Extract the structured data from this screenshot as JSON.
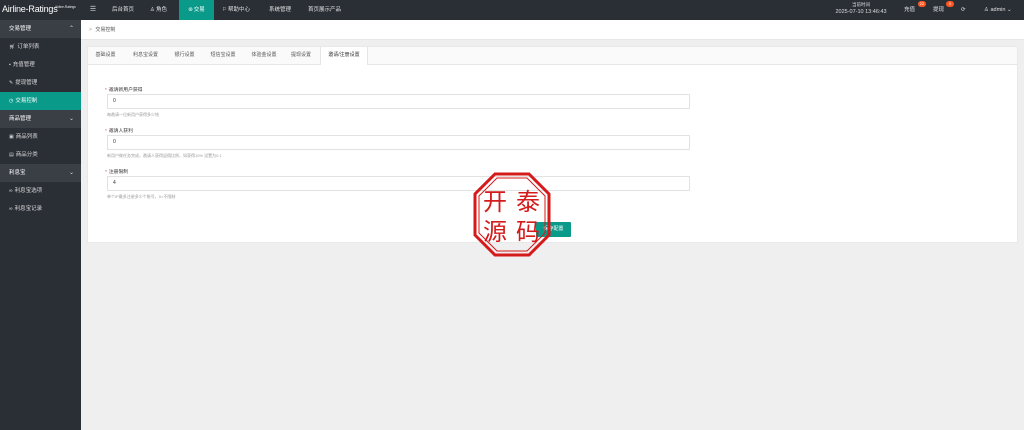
{
  "app": {
    "logo_text": "Airline-Ratings",
    "logo_subtext": "Airline-Ratings"
  },
  "topnav": {
    "items": [
      {
        "label": "后台首页",
        "icon": ""
      },
      {
        "label": "角色",
        "icon": "user-icon"
      },
      {
        "label": "交易",
        "icon": "trade-icon"
      },
      {
        "label": "帮助中心",
        "icon": "flag-icon"
      },
      {
        "label": "系统管理",
        "icon": ""
      },
      {
        "label": "首页展示产品",
        "icon": ""
      }
    ],
    "active_index": 2,
    "time_label": "当前时间",
    "time_value": "2025-07-10 13:46:43",
    "recharge_label": "充值",
    "recharge_badge": "22",
    "withdraw_label": "提现",
    "withdraw_badge": "0",
    "user_label": "admin"
  },
  "sidebar": {
    "groups": [
      {
        "label": "交易管理",
        "items": [
          {
            "label": "订单列表",
            "icon": "cart-icon"
          },
          {
            "label": "充值管理",
            "icon": "comment-icon"
          },
          {
            "label": "提现管理",
            "icon": "wrench-icon"
          },
          {
            "label": "交易控制",
            "icon": "clock-icon",
            "active": true
          }
        ]
      },
      {
        "label": "商品管理",
        "items": [
          {
            "label": "商品列表",
            "icon": "goods-icon"
          },
          {
            "label": "商品分类",
            "icon": "file-icon"
          }
        ]
      },
      {
        "label": "利息宝",
        "items": [
          {
            "label": "利息宝选项",
            "icon": "link-icon"
          },
          {
            "label": "利息宝记录",
            "icon": "link-icon"
          }
        ]
      }
    ]
  },
  "breadcrumb": {
    "title": "交易控制"
  },
  "tabs": [
    "基础设置",
    "利息宝设置",
    "银行设置",
    "短信宝设置",
    "体验金设置",
    "提现设置",
    "邀请/注册设置"
  ],
  "active_tab": 6,
  "form": {
    "fields": [
      {
        "label": "邀请新用户获得",
        "value": "0",
        "hint": "每邀请一位新用户获得多少钱"
      },
      {
        "label": "邀请人获利",
        "value": "0",
        "hint": "新用户做任务完成，邀请人获得返佣比例，如获得10% 设置为0.1"
      },
      {
        "label": "注册限制",
        "value": "4",
        "hint": "单个IP最多注册多少个账号，0=不限制"
      }
    ],
    "save_label": "保存配置"
  },
  "stamp": {
    "chars": [
      "开",
      "泰",
      "源",
      "码"
    ]
  },
  "colors": {
    "accent": "#0a9a8a",
    "topbar": "#2a2f36",
    "badge": "#ff5722",
    "required": "#e53935",
    "stamp": "#d41a1a"
  }
}
